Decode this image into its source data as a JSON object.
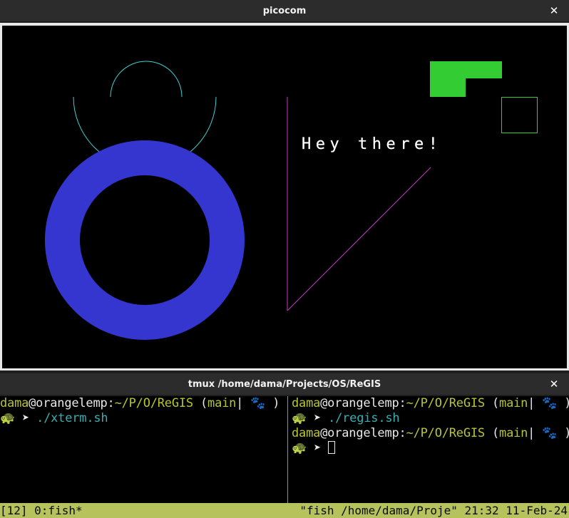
{
  "window_top": {
    "title": "picocom",
    "close_glyph": "✕"
  },
  "canvas": {
    "text": "Hey there!",
    "colors": {
      "ring": "#3535d0",
      "arc": "#3ecfd6",
      "line": "#c43dc4",
      "rect_fill": "#33cc33",
      "rect_outline": "#33cc33",
      "text": "#ffffff"
    }
  },
  "window_bottom": {
    "title": "tmux /home/dama/Projects/OS/ReGIS",
    "close_glyph": "✕"
  },
  "panes": {
    "left": {
      "prompt": {
        "user": "dama",
        "host": "@orangelemp:",
        "cwd": "~/P/O/ReGIS",
        "branch_open": " (",
        "branch": "main",
        "branch_sep": "| ",
        "paw": "🐾",
        "branch_close": " )"
      },
      "turtle": "🐢",
      "arrow": " ➤ ",
      "command": "./xterm.sh"
    },
    "right": {
      "prompt1": {
        "user": "dama",
        "host": "@orangelemp:",
        "cwd": "~/P/O/ReGIS",
        "branch_open": " (",
        "branch": "main",
        "branch_sep": "| ",
        "paw": "🐾",
        "branch_close": " )"
      },
      "turtle": "🐢",
      "arrow": " ➤ ",
      "command": "./regis.sh",
      "prompt2": {
        "user": "dama",
        "host": "@orangelemp:",
        "cwd": "~/P/O/ReGIS",
        "branch_open": " (",
        "branch": "main",
        "branch_sep": "| ",
        "paw": "🐾",
        "branch_close": " )"
      }
    }
  },
  "statusbar": {
    "session": "[12] 0:fish*",
    "right_text": "\"fish /home/dama/Proje\" 21:32 11-Feb-24"
  }
}
